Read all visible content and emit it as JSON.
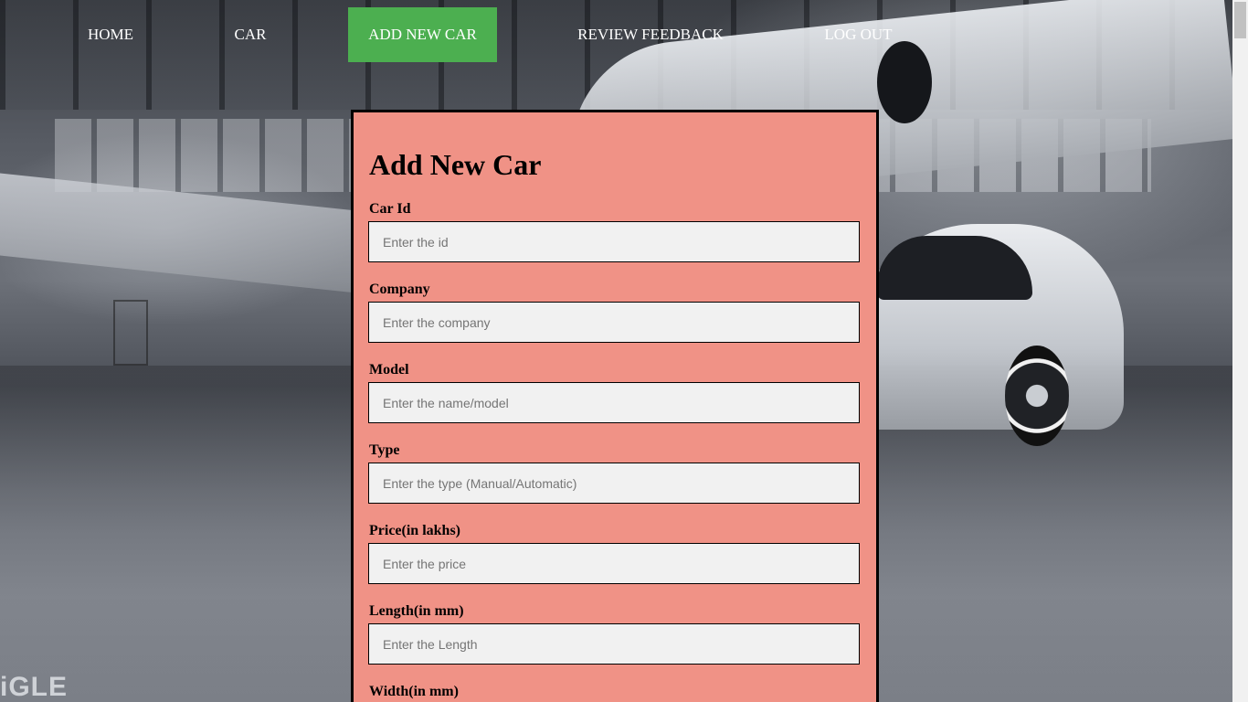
{
  "nav": {
    "items": [
      {
        "label": "HOME",
        "active": false
      },
      {
        "label": "CAR",
        "active": false
      },
      {
        "label": "ADD NEW CAR",
        "active": true
      },
      {
        "label": "REVIEW FEEDBACK",
        "active": false
      },
      {
        "label": "LOG OUT",
        "active": false
      }
    ],
    "active_color": "#4caf50"
  },
  "form": {
    "title": "Add New Car",
    "background_color": "#f09286",
    "fields": [
      {
        "label": "Car Id",
        "placeholder": "Enter the id"
      },
      {
        "label": "Company",
        "placeholder": "Enter the company"
      },
      {
        "label": "Model",
        "placeholder": "Enter the name/model"
      },
      {
        "label": "Type",
        "placeholder": "Enter the type (Manual/Automatic)"
      },
      {
        "label": "Price(in lakhs)",
        "placeholder": "Enter the price"
      },
      {
        "label": "Length(in mm)",
        "placeholder": "Enter the Length"
      },
      {
        "label": "Width(in mm)",
        "placeholder": ""
      }
    ]
  },
  "background": {
    "watermark": "iGLE"
  }
}
